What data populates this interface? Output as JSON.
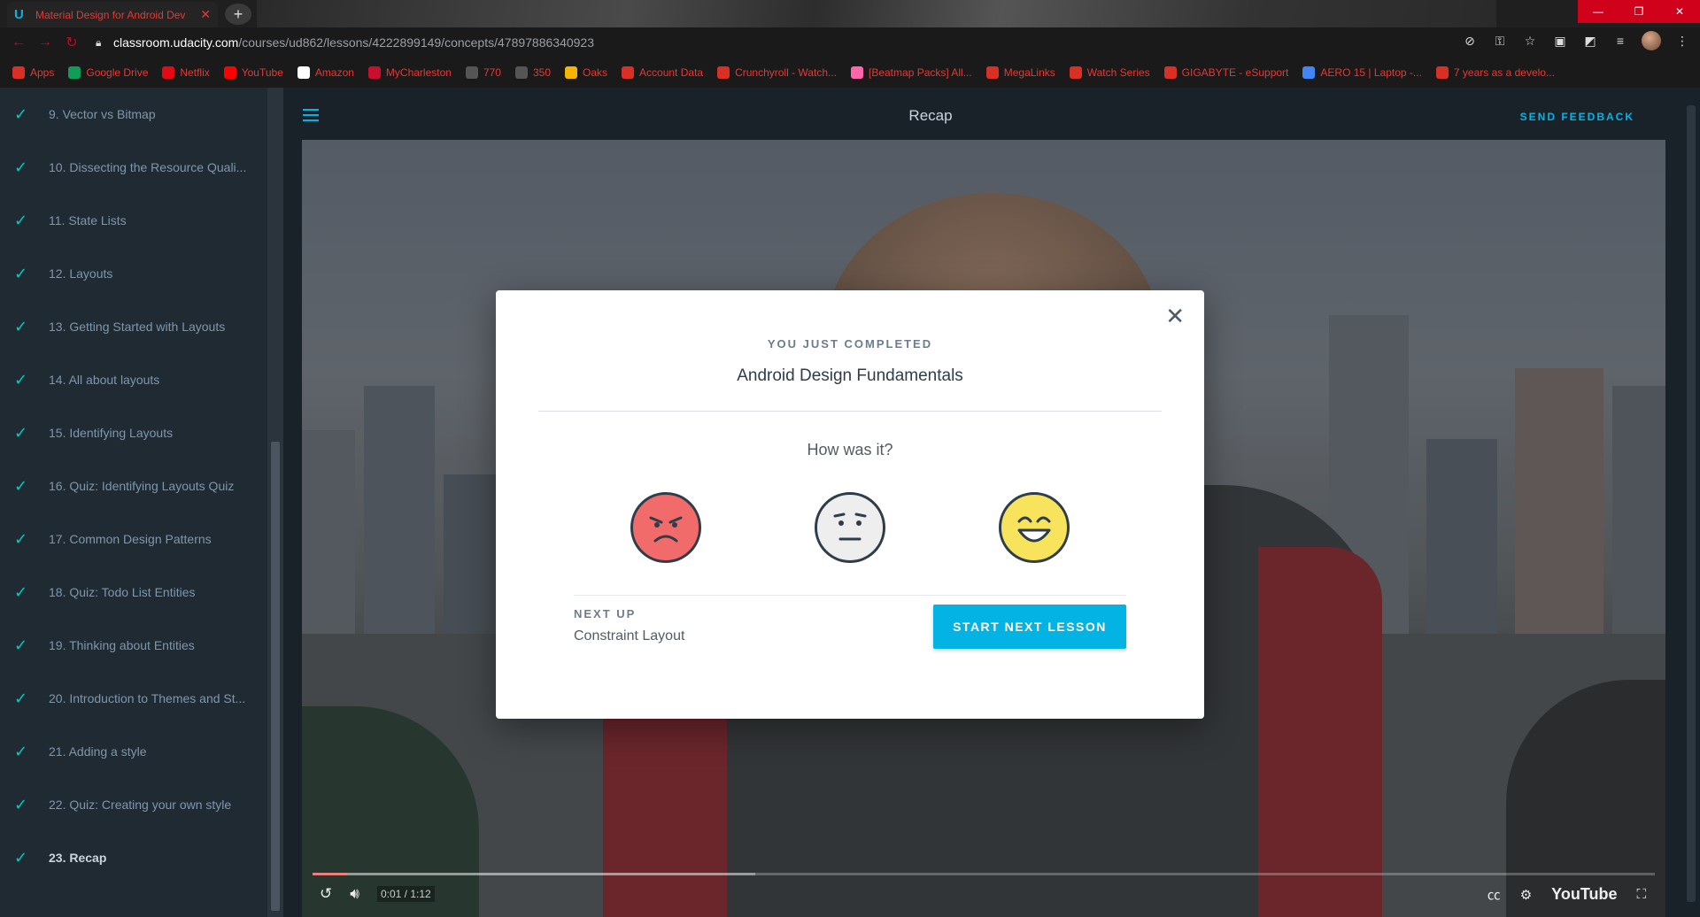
{
  "browser": {
    "tab_title": "Material Design for Android Dev",
    "url_host": "classroom.udacity.com",
    "url_path": "/courses/ud862/lessons/4222899149/concepts/47897886340923",
    "bookmarks": [
      {
        "label": "Apps",
        "icon": "apps-icon",
        "color": "#d93025"
      },
      {
        "label": "Google Drive",
        "icon": "drive-icon",
        "color": "#0f9d58"
      },
      {
        "label": "Netflix",
        "icon": "netflix-icon",
        "color": "#e50914"
      },
      {
        "label": "YouTube",
        "icon": "youtube-icon",
        "color": "#ff0000"
      },
      {
        "label": "Amazon",
        "icon": "amazon-icon",
        "color": "#ffffff"
      },
      {
        "label": "MyCharleston",
        "icon": "charleston-icon",
        "color": "#c8102e"
      },
      {
        "label": "770",
        "icon": "bookmark-icon",
        "color": "#555555"
      },
      {
        "label": "350",
        "icon": "github-icon",
        "color": "#555555"
      },
      {
        "label": "Oaks",
        "icon": "oaks-icon",
        "color": "#f4b400"
      },
      {
        "label": "Account Data",
        "icon": "web-icon",
        "color": "#d93025"
      },
      {
        "label": "Crunchyroll - Watch...",
        "icon": "crunchyroll-icon",
        "color": "#d93025"
      },
      {
        "label": "[Beatmap Packs] All...",
        "icon": "osu-icon",
        "color": "#ff66aa"
      },
      {
        "label": "MegaLinks",
        "icon": "web-icon",
        "color": "#d93025"
      },
      {
        "label": "Watch Series",
        "icon": "web-icon",
        "color": "#d93025"
      },
      {
        "label": "GIGABYTE - eSupport",
        "icon": "gigabyte-icon",
        "color": "#d93025"
      },
      {
        "label": "AERO 15 | Laptop -...",
        "icon": "google-icon",
        "color": "#4285f4"
      },
      {
        "label": "7 years as a develo...",
        "icon": "web-icon",
        "color": "#d93025"
      }
    ]
  },
  "sidebar": {
    "items": [
      {
        "label": "9. Vector vs Bitmap"
      },
      {
        "label": "10. Dissecting the Resource Quali..."
      },
      {
        "label": "11. State Lists"
      },
      {
        "label": "12. Layouts"
      },
      {
        "label": "13. Getting Started with Layouts"
      },
      {
        "label": "14. All about layouts"
      },
      {
        "label": "15. Identifying Layouts"
      },
      {
        "label": "16. Quiz: Identifying Layouts Quiz"
      },
      {
        "label": "17. Common Design Patterns"
      },
      {
        "label": "18. Quiz: Todo List Entities"
      },
      {
        "label": "19. Thinking about Entities"
      },
      {
        "label": "20. Introduction to Themes and St..."
      },
      {
        "label": "21. Adding a style"
      },
      {
        "label": "22. Quiz: Creating your own style"
      },
      {
        "label": "23. Recap"
      }
    ]
  },
  "header": {
    "title": "Recap",
    "feedback_label": "SEND FEEDBACK"
  },
  "video": {
    "time": "0:01 / 1:12",
    "progress_fraction": 0.026,
    "player_brand": "YouTube"
  },
  "modal": {
    "eyebrow": "YOU JUST COMPLETED",
    "lesson_name": "Android Design Fundamentals",
    "question": "How was it?",
    "ratings": [
      "angry-face-icon",
      "neutral-face-icon",
      "happy-face-icon"
    ],
    "next_up_label": "NEXT UP",
    "next_lesson": "Constraint Layout",
    "start_button": "START NEXT LESSON"
  },
  "colors": {
    "accent": "#02b3e4",
    "check": "#02ccba"
  }
}
